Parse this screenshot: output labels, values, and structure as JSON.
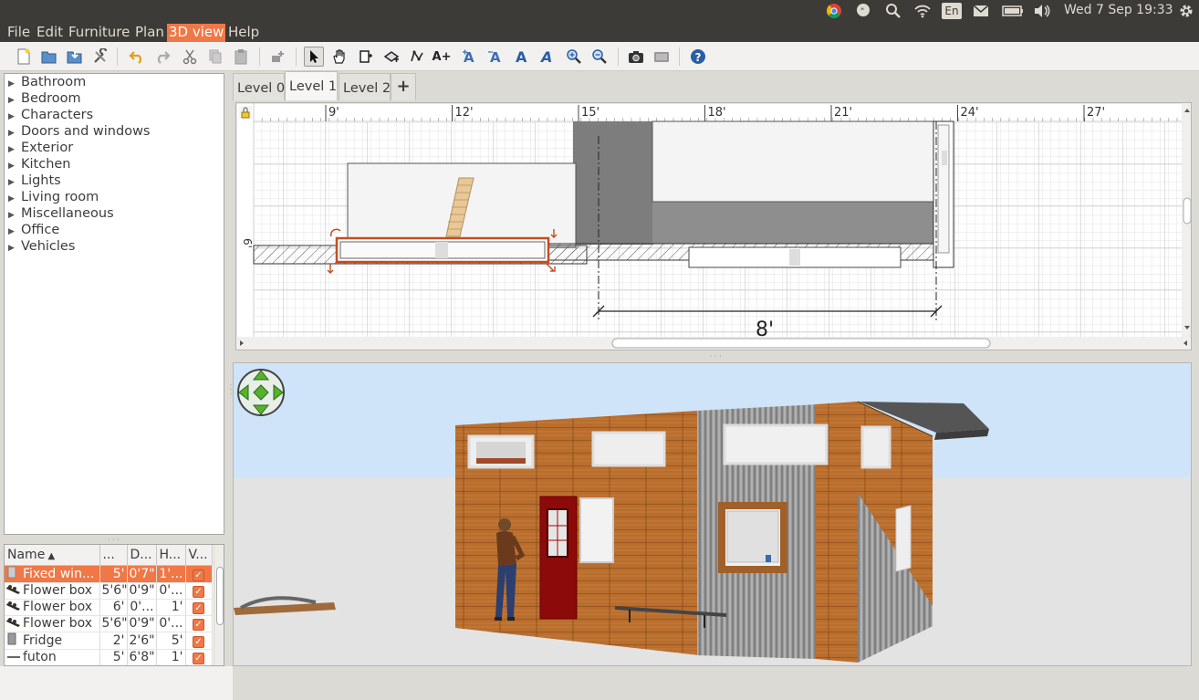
{
  "system_bar": {
    "clock": "Wed  7 Sep 19:33",
    "keyboard_layout": "En",
    "icons": [
      "chrome-icon",
      "chat-icon",
      "search-icon",
      "wifi-icon",
      "keyboard-icon",
      "mail-icon",
      "battery-icon",
      "volume-icon",
      "gear-icon"
    ]
  },
  "menu": {
    "file": "File",
    "edit": "Edit",
    "furniture": "Furniture",
    "plan": "Plan",
    "view3d": "3D view",
    "help": "Help"
  },
  "toolbar": {
    "text_tool_label": "A+",
    "icons": [
      "new-file-icon",
      "open-icon",
      "save-icon",
      "preferences-icon",
      "undo-icon",
      "redo-icon",
      "cut-icon",
      "copy-icon",
      "paste-icon",
      "add-furniture-icon",
      "select-arrow-icon",
      "pan-hand-icon",
      "create-walls-icon",
      "create-rooms-icon",
      "create-polylines-icon",
      "add-text-icon",
      "text-style-icon",
      "bold-icon",
      "italic-icon",
      "zoom-in-icon",
      "zoom-out-icon",
      "create-photo-icon",
      "create-video-icon",
      "help-icon"
    ]
  },
  "catalog": {
    "categories": [
      "Bathroom",
      "Bedroom",
      "Characters",
      "Doors and windows",
      "Exterior",
      "Kitchen",
      "Lights",
      "Living room",
      "Miscellaneous",
      "Office",
      "Vehicles"
    ]
  },
  "furniture_table": {
    "columns": [
      "Name",
      "...",
      "D...",
      "H...",
      "V..."
    ],
    "rows": [
      {
        "name": "Fixed win...",
        "width": "5'",
        "depth": "0'7\"",
        "height": "1'...",
        "visible": true,
        "selected": true
      },
      {
        "name": "Flower box",
        "width": "5'6\"",
        "depth": "0'9\"",
        "height": "0'...",
        "visible": true,
        "selected": false
      },
      {
        "name": "Flower box",
        "width": "6'",
        "depth": "0'...",
        "height": "1'",
        "visible": true,
        "selected": false
      },
      {
        "name": "Flower box",
        "width": "5'6\"",
        "depth": "0'9\"",
        "height": "0'...",
        "visible": true,
        "selected": false
      },
      {
        "name": "Fridge",
        "width": "2'",
        "depth": "2'6\"",
        "height": "5'",
        "visible": true,
        "selected": false
      },
      {
        "name": "futon",
        "width": "5'",
        "depth": "6'8\"",
        "height": "1'",
        "visible": true,
        "selected": false
      }
    ]
  },
  "levels": {
    "tabs": [
      "Level 0",
      "Level 1",
      "Level 2"
    ],
    "active": "Level 1",
    "add_label": "+"
  },
  "plan": {
    "ruler_top": [
      "9'",
      "12'",
      "15'",
      "18'",
      "21'",
      "24'",
      "27'"
    ],
    "ruler_left": [
      "6'"
    ],
    "dimension_label": "8'"
  },
  "colors": {
    "accent": "#f07746",
    "system_bar": "#3c3b37",
    "sky": "#cfe4f8",
    "ground": "#e4e4e4",
    "wood": "#b5682b",
    "metal": "#8a8a8a",
    "door": "#8c0a0a"
  }
}
